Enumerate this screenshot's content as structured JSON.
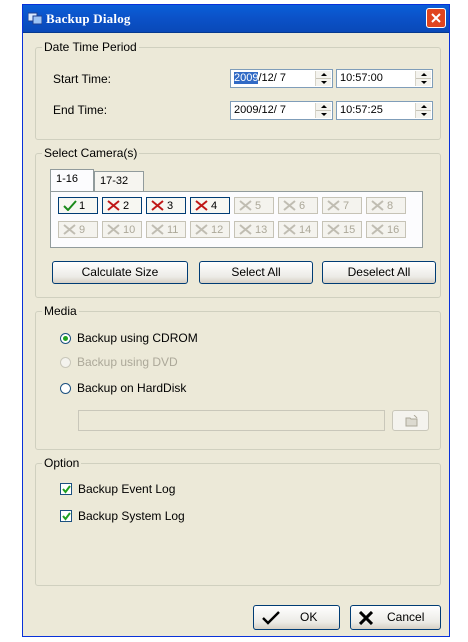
{
  "window": {
    "title": "Backup Dialog"
  },
  "date_time": {
    "legend": "Date Time Period",
    "start_label": "Start Time:",
    "start_date_selected": "2009",
    "start_date_rest": "/12/  7",
    "start_time": "10:57:00",
    "end_label": "End Time:",
    "end_date": "2009/12/  7",
    "end_time": "10:57:25"
  },
  "cameras": {
    "legend": "Select Camera(s)",
    "tabs": [
      "1-16",
      "17-32"
    ],
    "items": [
      {
        "label": "1",
        "state": "checked"
      },
      {
        "label": "2",
        "state": "unchecked"
      },
      {
        "label": "3",
        "state": "unchecked"
      },
      {
        "label": "4",
        "state": "unchecked"
      },
      {
        "label": "5",
        "state": "disabled"
      },
      {
        "label": "6",
        "state": "disabled"
      },
      {
        "label": "7",
        "state": "disabled"
      },
      {
        "label": "8",
        "state": "disabled"
      },
      {
        "label": "9",
        "state": "disabled"
      },
      {
        "label": "10",
        "state": "disabled"
      },
      {
        "label": "11",
        "state": "disabled"
      },
      {
        "label": "12",
        "state": "disabled"
      },
      {
        "label": "13",
        "state": "disabled"
      },
      {
        "label": "14",
        "state": "disabled"
      },
      {
        "label": "15",
        "state": "disabled"
      },
      {
        "label": "16",
        "state": "disabled"
      }
    ],
    "calculate_label": "Calculate Size",
    "select_all_label": "Select All",
    "deselect_all_label": "Deselect All"
  },
  "media": {
    "legend": "Media",
    "cdrom_label": "Backup using CDROM",
    "dvd_label": "Backup using DVD",
    "harddisk_label": "Backup on HardDisk",
    "path_value": ""
  },
  "option": {
    "legend": "Option",
    "event_log_label": "Backup Event Log",
    "system_log_label": "Backup System Log"
  },
  "footer": {
    "ok_label": "OK",
    "cancel_label": "Cancel"
  },
  "colors": {
    "check_green": "#1a8a1a",
    "x_red": "#c01818",
    "title_blue": "#0a5fd8"
  }
}
